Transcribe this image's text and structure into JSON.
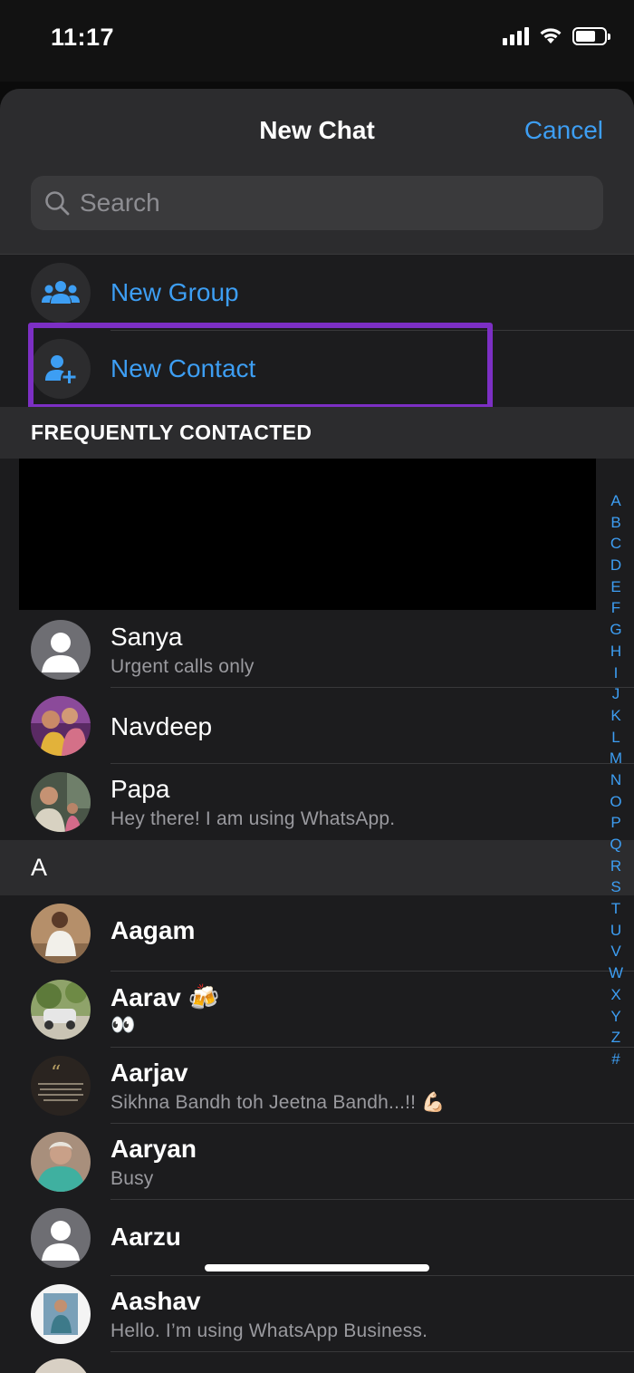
{
  "status_bar": {
    "time": "11:17",
    "battery_level": 0.7
  },
  "header": {
    "title": "New Chat",
    "cancel_label": "Cancel",
    "search_placeholder": "Search"
  },
  "actions": [
    {
      "label": "New Group",
      "icon": "group-icon"
    },
    {
      "label": "New Contact",
      "icon": "add-contact-icon"
    }
  ],
  "sections": {
    "frequent": "FREQUENTLY CONTACTED",
    "a": "A"
  },
  "frequent_contacts": [
    {
      "name": "Sanya",
      "status": "Urgent calls only",
      "avatar": "default-avatar"
    },
    {
      "name": "Navdeep",
      "status": "",
      "avatar": "photo"
    },
    {
      "name": "Papa",
      "status": "Hey there! I am using WhatsApp.",
      "avatar": "photo"
    }
  ],
  "a_contacts": [
    {
      "name": "Aagam",
      "status": "",
      "avatar": "photo"
    },
    {
      "name": "Aarav 🍻",
      "status": "👀",
      "avatar": "photo"
    },
    {
      "name": "Aarjav",
      "status": "Sikhna Bandh toh Jeetna Bandh...!! 💪🏻",
      "avatar": "photo"
    },
    {
      "name": "Aaryan",
      "status": "Busy",
      "avatar": "photo"
    },
    {
      "name": "Aarzu",
      "status": "",
      "avatar": "default-avatar"
    },
    {
      "name": "Aashav",
      "status": "Hello. I’m using WhatsApp Business.",
      "avatar": "photo"
    }
  ],
  "index_letters": [
    "A",
    "B",
    "C",
    "D",
    "E",
    "F",
    "G",
    "H",
    "I",
    "J",
    "K",
    "L",
    "M",
    "N",
    "O",
    "P",
    "Q",
    "R",
    "S",
    "T",
    "U",
    "V",
    "W",
    "X",
    "Y",
    "Z",
    "#"
  ],
  "colors": {
    "accent": "#3d9ef3",
    "highlight": "#7c2fc4"
  }
}
